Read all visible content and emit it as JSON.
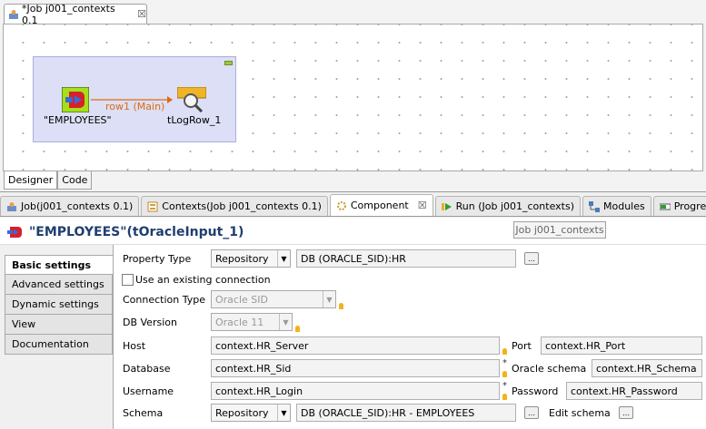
{
  "editor": {
    "tab_label": "*Job j001_contexts 0.1",
    "nodes": {
      "input_label": "\"EMPLOYEES\"",
      "output_label": "tLogRow_1",
      "link_label": "row1 (Main)"
    },
    "bottom_tabs": [
      "Designer",
      "Code"
    ]
  },
  "views": {
    "tabs": [
      {
        "label": "Job(j001_contexts 0.1)",
        "icon": "job-icon"
      },
      {
        "label": "Contexts(Job j001_contexts 0.1)",
        "icon": "contexts-icon"
      },
      {
        "label": "Component",
        "icon": "component-icon",
        "active": true
      },
      {
        "label": "Run (Job j001_contexts)",
        "icon": "run-icon"
      },
      {
        "label": "Modules",
        "icon": "modules-icon"
      },
      {
        "label": "Progress",
        "icon": "progress-icon"
      }
    ]
  },
  "component": {
    "title": "\"EMPLOYEES\"(tOracleInput_1)",
    "tooltip": "Job j001_contexts",
    "side_tabs": [
      "Basic settings",
      "Advanced settings",
      "Dynamic settings",
      "View",
      "Documentation"
    ],
    "fields": {
      "property_type_label": "Property Type",
      "property_type_value": "Repository",
      "property_db_value": "DB (ORACLE_SID):HR",
      "use_existing_label": "Use an existing connection",
      "connection_type_label": "Connection Type",
      "connection_type_value": "Oracle SID",
      "db_version_label": "DB Version",
      "db_version_value": "Oracle 11",
      "host_label": "Host",
      "host_value": "context.HR_Server",
      "port_label": "Port",
      "port_value": "context.HR_Port",
      "database_label": "Database",
      "database_value": "context.HR_Sid",
      "oracle_schema_label": "Oracle schema",
      "oracle_schema_value": "context.HR_Schema",
      "username_label": "Username",
      "username_value": "context.HR_Login",
      "password_label": "Password",
      "password_value": "context.HR_Password",
      "schema_label": "Schema",
      "schema_value": "Repository",
      "schema_db_value": "DB (ORACLE_SID):HR - EMPLOYEES",
      "edit_schema_label": "Edit schema"
    }
  },
  "colors": {
    "title": "#1f3f6f",
    "link": "#e06a10",
    "subjob": "#dcdff5"
  }
}
